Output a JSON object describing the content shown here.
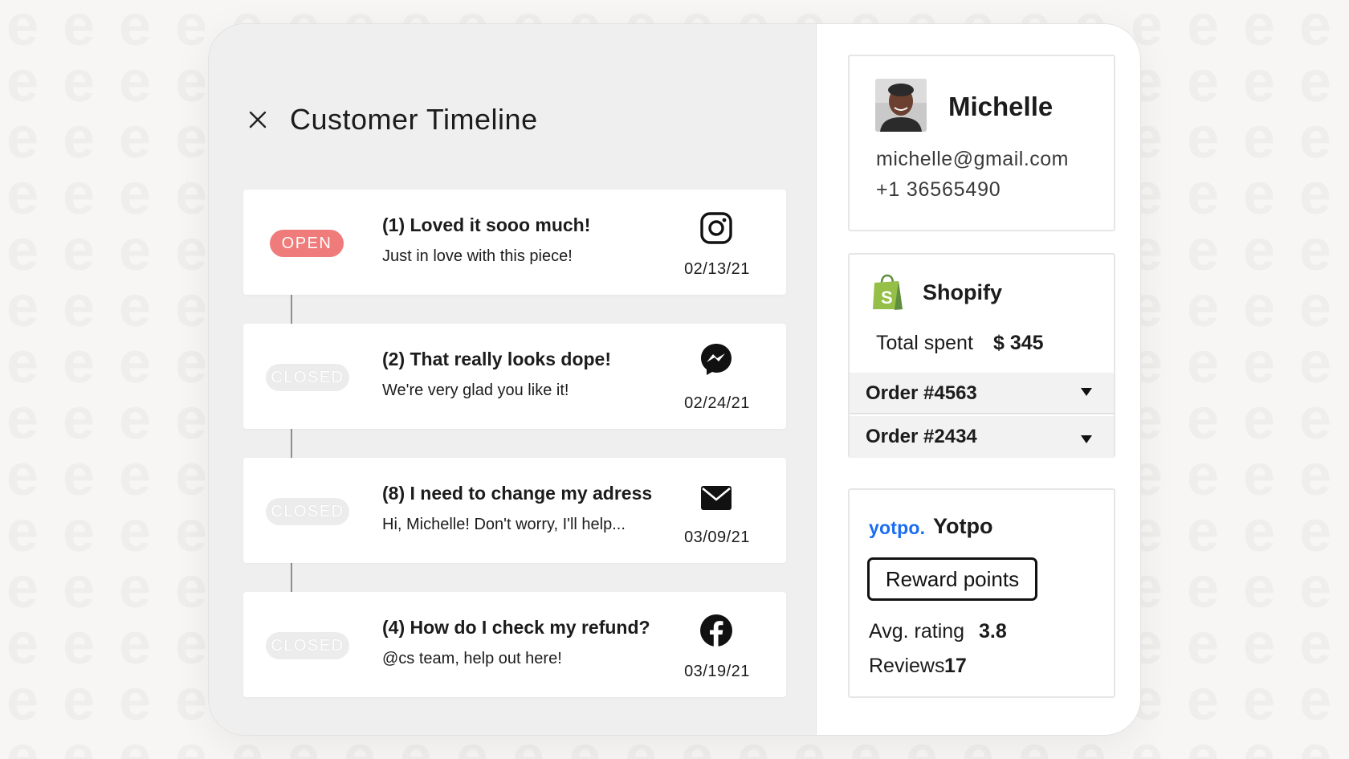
{
  "header": {
    "title": "Customer Timeline",
    "close_icon": "close-icon"
  },
  "timeline": [
    {
      "status": "OPEN",
      "title": "(1) Loved it sooo much!",
      "preview": "Just in love with this piece!",
      "channel_icon": "instagram-icon",
      "date": "02/13/21"
    },
    {
      "status": "CLOSED",
      "title": "(2) That really looks dope!",
      "preview": "We're very glad you like it!",
      "channel_icon": "messenger-icon",
      "date": "02/24/21"
    },
    {
      "status": "CLOSED",
      "title": "(8) I need to change my adress",
      "preview": "Hi, Michelle! Don't worry, I'll help...",
      "channel_icon": "mail-icon",
      "date": "03/09/21"
    },
    {
      "status": "CLOSED",
      "title": "(4) How do I check my refund?",
      "preview": "@cs team, help out here!",
      "channel_icon": "facebook-icon",
      "date": "03/19/21"
    }
  ],
  "customer": {
    "name": "Michelle",
    "email": "michelle@gmail.com",
    "phone": "+1 36565490"
  },
  "shopify": {
    "name": "Shopify",
    "total_label": "Total spent",
    "total_value": "$ 345",
    "orders": [
      {
        "label": "Order #4563"
      },
      {
        "label": "Order #2434"
      }
    ]
  },
  "yotpo": {
    "logo_text": "yotpo.",
    "name": "Yotpo",
    "reward_button": "Reward points",
    "rating_label": "Avg. rating",
    "rating_value": "3.8",
    "reviews_label": "Reviews",
    "reviews_value": "17"
  },
  "colors": {
    "open_badge": "#ef7b7a",
    "closed_badge": "#ececec",
    "yotpo_blue": "#1a6cf2",
    "shopify_green": "#95bf47"
  }
}
